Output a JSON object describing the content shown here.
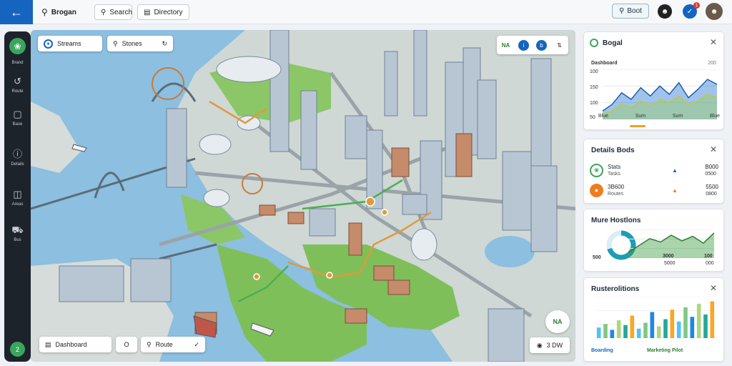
{
  "topbar": {
    "back_icon": "arrow-left-icon",
    "app_name": "Brogan",
    "search_label": "Search",
    "directory_label": "Directory",
    "right_button": "Boot",
    "notification_count": "1",
    "colors": {
      "brand": "#1565c0",
      "accent": "#3aa55d"
    }
  },
  "rail": {
    "items": [
      {
        "icon": "leaf-icon",
        "label": "Brand"
      },
      {
        "icon": "route-icon",
        "label": "Route"
      },
      {
        "icon": "square-icon",
        "label": "Base"
      },
      {
        "icon": "info-icon",
        "label": "Details"
      },
      {
        "icon": "layers-icon",
        "label": "Areas"
      },
      {
        "icon": "car-icon",
        "label": "Bus"
      }
    ],
    "bottom_label": "2"
  },
  "map": {
    "chip_top_left": "Streams",
    "chip_top_second": "Stones",
    "tools": [
      "NA",
      "i",
      "b",
      "arrows"
    ],
    "bottom_chip_1": "Dashboard",
    "bottom_chip_2": "O",
    "bottom_chip_3": "Route",
    "bottom_right_label": "3 DW",
    "bottom_right_icon_label": "NA"
  },
  "panel_1": {
    "title": "Bogal",
    "chart_title": "Dashboard",
    "chart_right_label": "200",
    "y_ticks": [
      "100",
      "150",
      "100",
      "50"
    ],
    "x_ticks": [
      "Blue",
      "Sum",
      "Sum",
      "Blue"
    ],
    "chart_data": {
      "type": "area",
      "x": [
        0,
        1,
        2,
        3,
        4,
        5,
        6,
        7,
        8,
        9,
        10,
        11,
        12
      ],
      "series": [
        {
          "values": [
            10,
            18,
            32,
            24,
            38,
            28,
            40,
            30,
            44,
            26,
            36,
            48,
            42
          ]
        },
        {
          "values": [
            6,
            10,
            18,
            14,
            22,
            16,
            24,
            20,
            28,
            18,
            22,
            30,
            26
          ]
        }
      ],
      "ylim": [
        0,
        60
      ]
    }
  },
  "panel_2": {
    "title": "Details Bods",
    "rows": [
      {
        "icon": "leaf-icon",
        "name": "Stats",
        "sub": "Tasks",
        "value": "B000",
        "sub_value": "0500"
      },
      {
        "icon": "bus-icon",
        "name": "3B600",
        "sub": "Routes",
        "value": "5500",
        "sub_value": "0800"
      }
    ]
  },
  "panel_3": {
    "title": "Mure Hostlons",
    "left_value": "500",
    "mid_value": "3000",
    "mid_sub": "5000",
    "right_value": "100",
    "right_sub": "000",
    "chart_data": {
      "type": "area",
      "x": [
        0,
        1,
        2,
        3,
        4,
        5,
        6,
        7,
        8
      ],
      "series": [
        {
          "values": [
            10,
            22,
            34,
            28,
            40,
            30,
            38,
            26,
            44
          ]
        }
      ],
      "ylim": [
        0,
        50
      ]
    }
  },
  "panel_4": {
    "title": "Rusterolitions",
    "footer_left": "Boarding",
    "footer_right": "Marketing Pilot",
    "chart_data": {
      "type": "bar",
      "categories": [
        "1",
        "2",
        "3",
        "4",
        "5",
        "6",
        "7",
        "8",
        "9",
        "10",
        "11",
        "12",
        "13",
        "14",
        "15",
        "16",
        "17",
        "18"
      ],
      "values": [
        18,
        24,
        14,
        30,
        22,
        38,
        16,
        26,
        44,
        20,
        32,
        48,
        28,
        52,
        36,
        58,
        40,
        62
      ],
      "ylim": [
        0,
        70
      ]
    }
  }
}
